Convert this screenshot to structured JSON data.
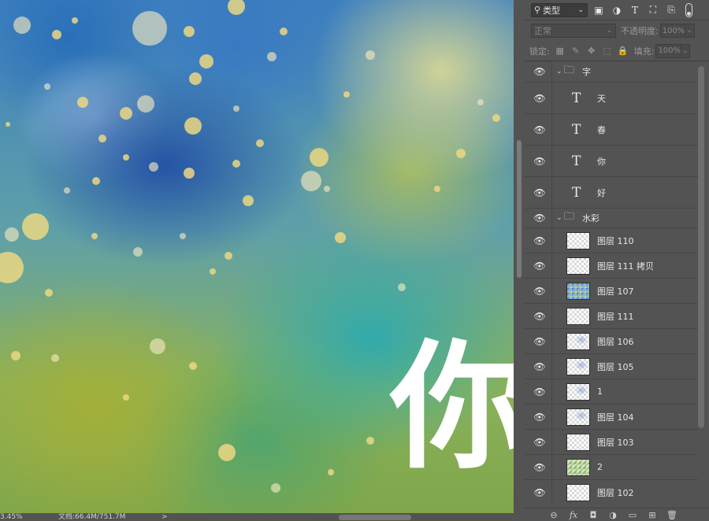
{
  "canvas": {
    "brush_glyph": "你",
    "colors": {
      "blue": "#2a5fb0",
      "yellow": "#d8d49a",
      "teal": "#34a9b0",
      "green": "#9aad3c",
      "spots": "#ebd782"
    }
  },
  "status_bar": {
    "zoom": "3.45%",
    "doc_info": "文档:66.4M/751.7M",
    "arrow": ">"
  },
  "layers_panel": {
    "filter": {
      "label": "类型",
      "icons": [
        "image-filter-icon",
        "adjustment-filter-icon",
        "type-filter-icon",
        "shape-filter-icon",
        "smart-object-filter-icon"
      ]
    },
    "blend_mode": "正常",
    "opacity_label": "不透明度:",
    "opacity_value": "100%",
    "lock_label": "锁定:",
    "fill_label": "填充:",
    "fill_value": "100%",
    "groups": [
      {
        "name": "字",
        "layers": [
          {
            "name": "天"
          },
          {
            "name": "春"
          },
          {
            "name": "你"
          },
          {
            "name": "好"
          }
        ]
      },
      {
        "name": "水彩",
        "layers": [
          {
            "name": "图层 110"
          },
          {
            "name": "图层 111 拷贝"
          },
          {
            "name": "图层 107"
          },
          {
            "name": "图层 111"
          },
          {
            "name": "图层 106"
          },
          {
            "name": "图层 105"
          },
          {
            "name": "1"
          },
          {
            "name": "图层 104"
          },
          {
            "name": "图层 103"
          },
          {
            "name": "2"
          },
          {
            "name": "图层 102"
          }
        ]
      }
    ],
    "footer_icons": [
      "link-layers-icon",
      "fx-icon",
      "mask-icon",
      "adjustment-layer-icon",
      "new-group-icon",
      "new-layer-icon",
      "delete-layer-icon"
    ],
    "footer_labels": {
      "link": "⊖",
      "fx": "fx",
      "mask": "◘",
      "adjust": "◑",
      "group": "▭",
      "new": "⊞",
      "delete": "🗑"
    }
  }
}
